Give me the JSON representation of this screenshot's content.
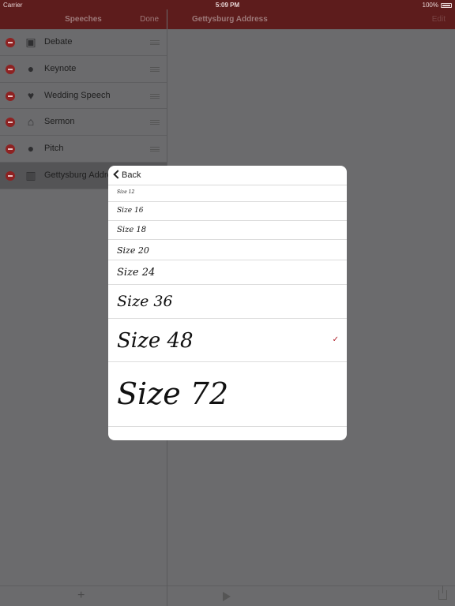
{
  "status_bar": {
    "carrier": "Carrier",
    "wifi_icon": "wifi-icon",
    "time": "5:09 PM",
    "battery_percent": "100%",
    "battery_level": 1.0
  },
  "left_nav": {
    "title": "Speeches",
    "done_label": "Done"
  },
  "right_nav": {
    "title": "Gettysburg Address",
    "edit_label": "Edit"
  },
  "speeches": [
    {
      "label": "Debate",
      "icon": "speech-bubbles-icon",
      "glyph": "▣"
    },
    {
      "label": "Keynote",
      "icon": "lightbulb-icon",
      "glyph": "●"
    },
    {
      "label": "Wedding Speech",
      "icon": "heart-icon",
      "glyph": "♥"
    },
    {
      "label": "Sermon",
      "icon": "church-icon",
      "glyph": "⌂"
    },
    {
      "label": "Pitch",
      "icon": "lightbulb-icon",
      "glyph": "●"
    },
    {
      "label": "Gettysburg Address",
      "icon": "monument-icon",
      "glyph": "▥",
      "selected": true
    }
  ],
  "toolbar": {
    "add_glyph": "+"
  },
  "popover": {
    "back_label": "Back",
    "sizes": [
      {
        "label": "Size 12",
        "checked": false
      },
      {
        "label": "Size 16",
        "checked": false
      },
      {
        "label": "Size 18",
        "checked": false
      },
      {
        "label": "Size 20",
        "checked": false
      },
      {
        "label": "Size 24",
        "checked": false
      },
      {
        "label": "Size 36",
        "checked": false
      },
      {
        "label": "Size 48",
        "checked": true
      },
      {
        "label": "Size 72",
        "checked": false
      }
    ],
    "check_glyph": "✓",
    "accent_color": "#b0202a"
  },
  "colors": {
    "nav_bar": "#5d1c1c",
    "dim_background": "#6b6b6d",
    "delete_badge": "#8e2222"
  }
}
